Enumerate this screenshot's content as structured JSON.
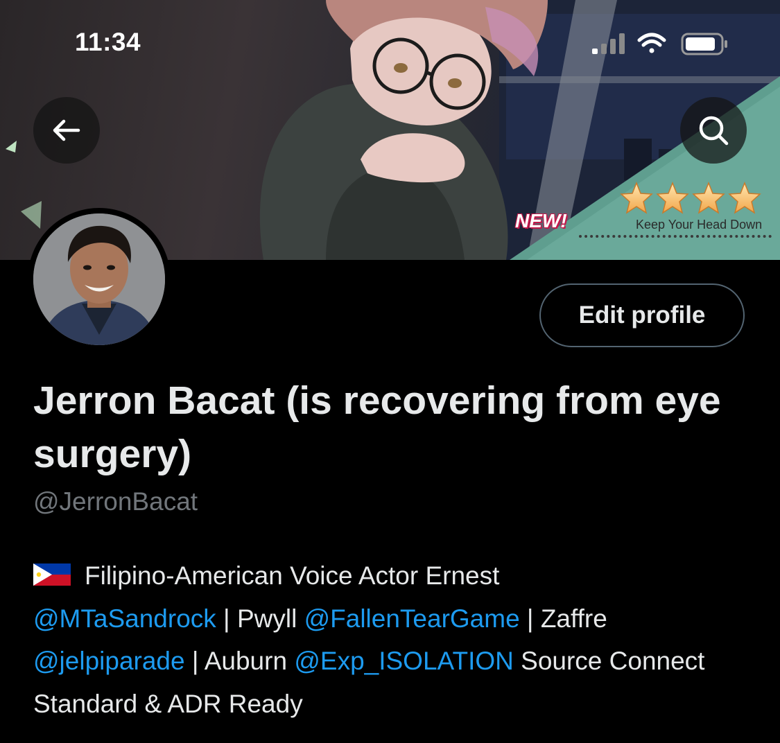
{
  "status_bar": {
    "time": "11:34"
  },
  "banner": {
    "badge_new": "NEW!",
    "game_title": "Keep Your Head Down",
    "rating_stars": 4
  },
  "header": {
    "back_icon": "arrow-left-icon",
    "search_icon": "search-icon"
  },
  "profile": {
    "edit_button_label": "Edit profile",
    "display_name": "Jerron Bacat (is recovering from eye surgery)",
    "handle": "@JerronBacat",
    "bio": {
      "flag": "philippines-flag-icon",
      "parts": [
        "Filipino-American Voice Actor Ernest",
        "@MTaSandrock",
        " | Pwyll ",
        "@FallenTearGame",
        " | Zaffre",
        "@jelpiparade",
        " | Auburn ",
        "@Exp_ISOLATION",
        " Source Connect Standard & ADR Ready"
      ]
    }
  },
  "colors": {
    "background": "#000000",
    "text_primary": "#e7e9ea",
    "text_secondary": "#71767b",
    "link": "#1d9bf0",
    "button_border": "#536471",
    "banner_teal": "#5f9e8f"
  }
}
